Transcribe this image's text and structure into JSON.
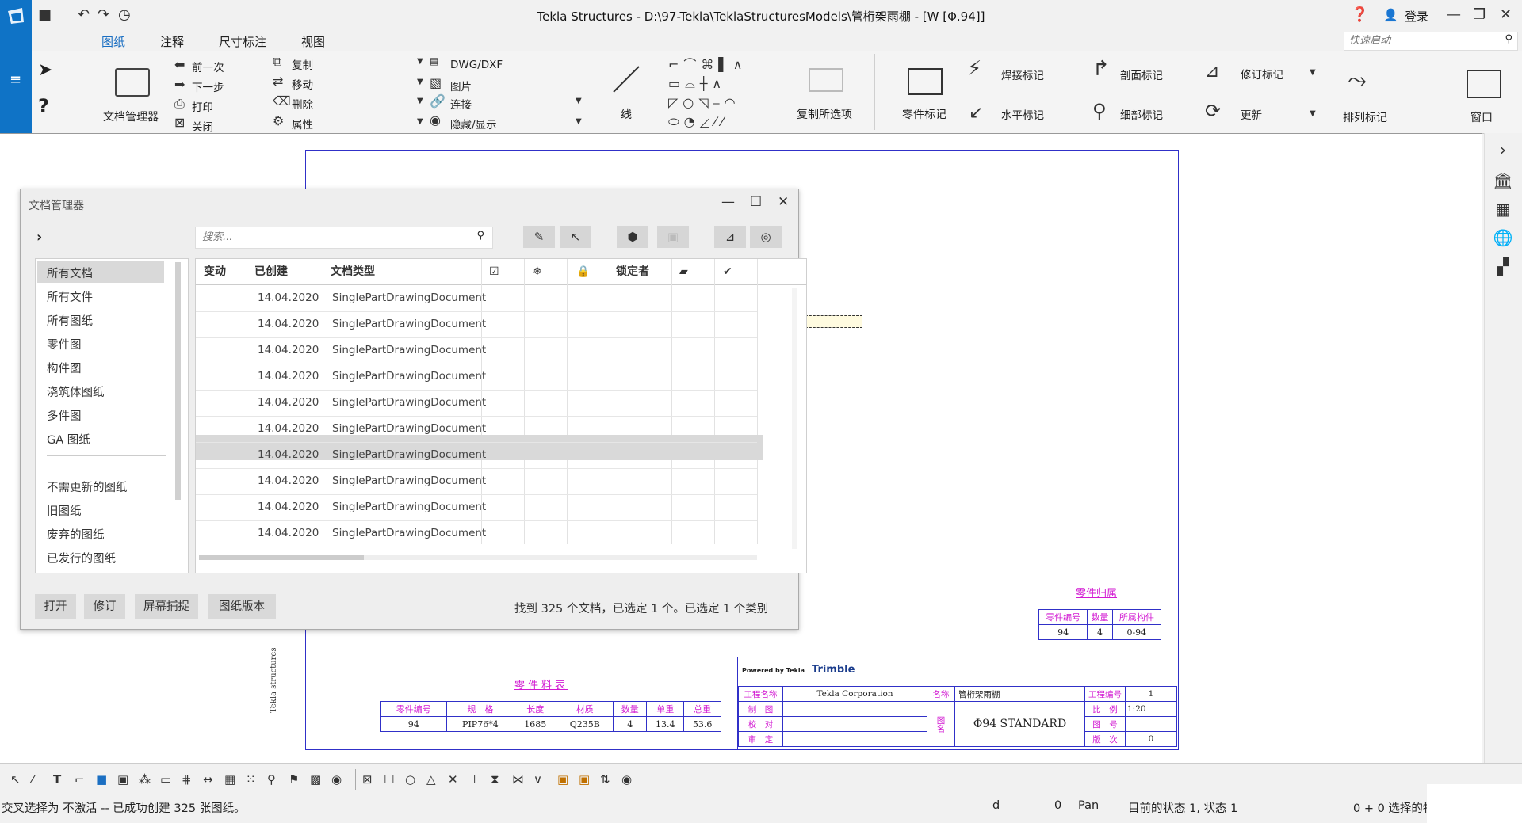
{
  "window": {
    "title": "Tekla Structures - D:\\97-Tekla\\TeklaStructuresModels\\管桁架雨棚 - [W   [Φ.94]]",
    "login_label": "登录",
    "quick_launch_placeholder": "快速启动"
  },
  "ribbon": {
    "tabs": [
      "图纸",
      "注释",
      "尺寸标注",
      "视图"
    ],
    "active_tab": "图纸",
    "doc_manager_label": "文档管理器",
    "nav": [
      "前一次",
      "下一步",
      "打印",
      "关闭"
    ],
    "edit": [
      "复制",
      "移动",
      "删除",
      "属性"
    ],
    "insert": [
      "DWG/DXF",
      "图片",
      "连接",
      "隐藏/显示"
    ],
    "line_label": "线",
    "copy_options_label": "复制所选项",
    "part_mark_label": "零件标记",
    "weld_mark_label": "焊接标记",
    "horizontal_mark_label": "水平标记",
    "section_mark_label": "剖面标记",
    "detail_mark_label": "细部标记",
    "revision_mark_label": "修订标记",
    "update_label": "更新",
    "arrange_marks_label": "排列标记",
    "window_label": "窗口"
  },
  "doc_manager": {
    "title": "文档管理器",
    "search_placeholder": "搜索...",
    "sidebar": [
      "所有文档",
      "所有文件",
      "所有图纸",
      "零件图",
      "构件图",
      "浇筑体图纸",
      "多件图",
      "GA 图纸",
      "不需更新的图纸",
      "旧图纸",
      "废弃的图纸",
      "已发行的图纸"
    ],
    "selected_sidebar": "所有文档",
    "columns": [
      "变动",
      "已创建",
      "文档类型",
      "",
      "",
      "",
      "锁定者",
      "",
      ""
    ],
    "rows": [
      {
        "created": "14.04.2020",
        "type": "SinglePartDrawingDocument"
      },
      {
        "created": "14.04.2020",
        "type": "SinglePartDrawingDocument"
      },
      {
        "created": "14.04.2020",
        "type": "SinglePartDrawingDocument"
      },
      {
        "created": "14.04.2020",
        "type": "SinglePartDrawingDocument"
      },
      {
        "created": "14.04.2020",
        "type": "SinglePartDrawingDocument"
      },
      {
        "created": "14.04.2020",
        "type": "SinglePartDrawingDocument"
      },
      {
        "created": "14.04.2020",
        "type": "SinglePartDrawingDocument"
      },
      {
        "created": "14.04.2020",
        "type": "SinglePartDrawingDocument"
      },
      {
        "created": "14.04.2020",
        "type": "SinglePartDrawingDocument"
      },
      {
        "created": "14.04.2020",
        "type": "SinglePartDrawingDocument"
      }
    ],
    "selected_row": 7,
    "buttons": [
      "打开",
      "修订",
      "屏幕捕捉",
      "图纸版本"
    ],
    "status": "找到 325 个文档，已选定 1 个。已选定 1 个类别"
  },
  "drawing": {
    "side_text": "Tekla structures",
    "part_list_title": "零件料表",
    "part_list_headers": [
      "零件编号",
      "规　格",
      "长度",
      "材质",
      "数量",
      "单重",
      "总重"
    ],
    "part_list_row": [
      "94",
      "PIP76*4",
      "1685",
      "Q235B",
      "4",
      "13.4",
      "53.6"
    ],
    "belong_title": "零件归属",
    "belong_headers": [
      "零件编号",
      "数量",
      "所属构件"
    ],
    "belong_row": [
      "94",
      "4",
      "0-94"
    ],
    "powered_by": "Powered by Tekla",
    "trimble": "Trimble",
    "tb_project_label": "工程名称",
    "tb_company": "Tekla Corporation",
    "tb_name_label": "名称",
    "tb_name_value": "管桁架雨棚",
    "tb_projno_label": "工程编号",
    "tb_projno_value": "1",
    "tb_draw_label": "制　图",
    "tb_check_label": "校　对",
    "tb_approve_label": "审　定",
    "tb_drawing_name_label": "图名",
    "tb_drawing_name": "Φ94 STANDARD",
    "tb_scale_label": "比　例",
    "tb_scale_value": "1:20",
    "tb_sheet_label": "图　号",
    "tb_rev_label": "版　次",
    "tb_rev_value": "0"
  },
  "status": {
    "message": "交叉选择为 不激活 -- 已成功创建 325 张图纸。",
    "d_label": "d",
    "d_value": "0",
    "pan": "Pan",
    "state": "目前的状态 1, 状态 1",
    "selection": "0 + 0 选择的物"
  },
  "colors": {
    "accent": "#1b6fc2",
    "drawing_frame": "#3030c8",
    "drawing_magenta": "#d21ad2",
    "left_strip": "#0f73c6"
  }
}
